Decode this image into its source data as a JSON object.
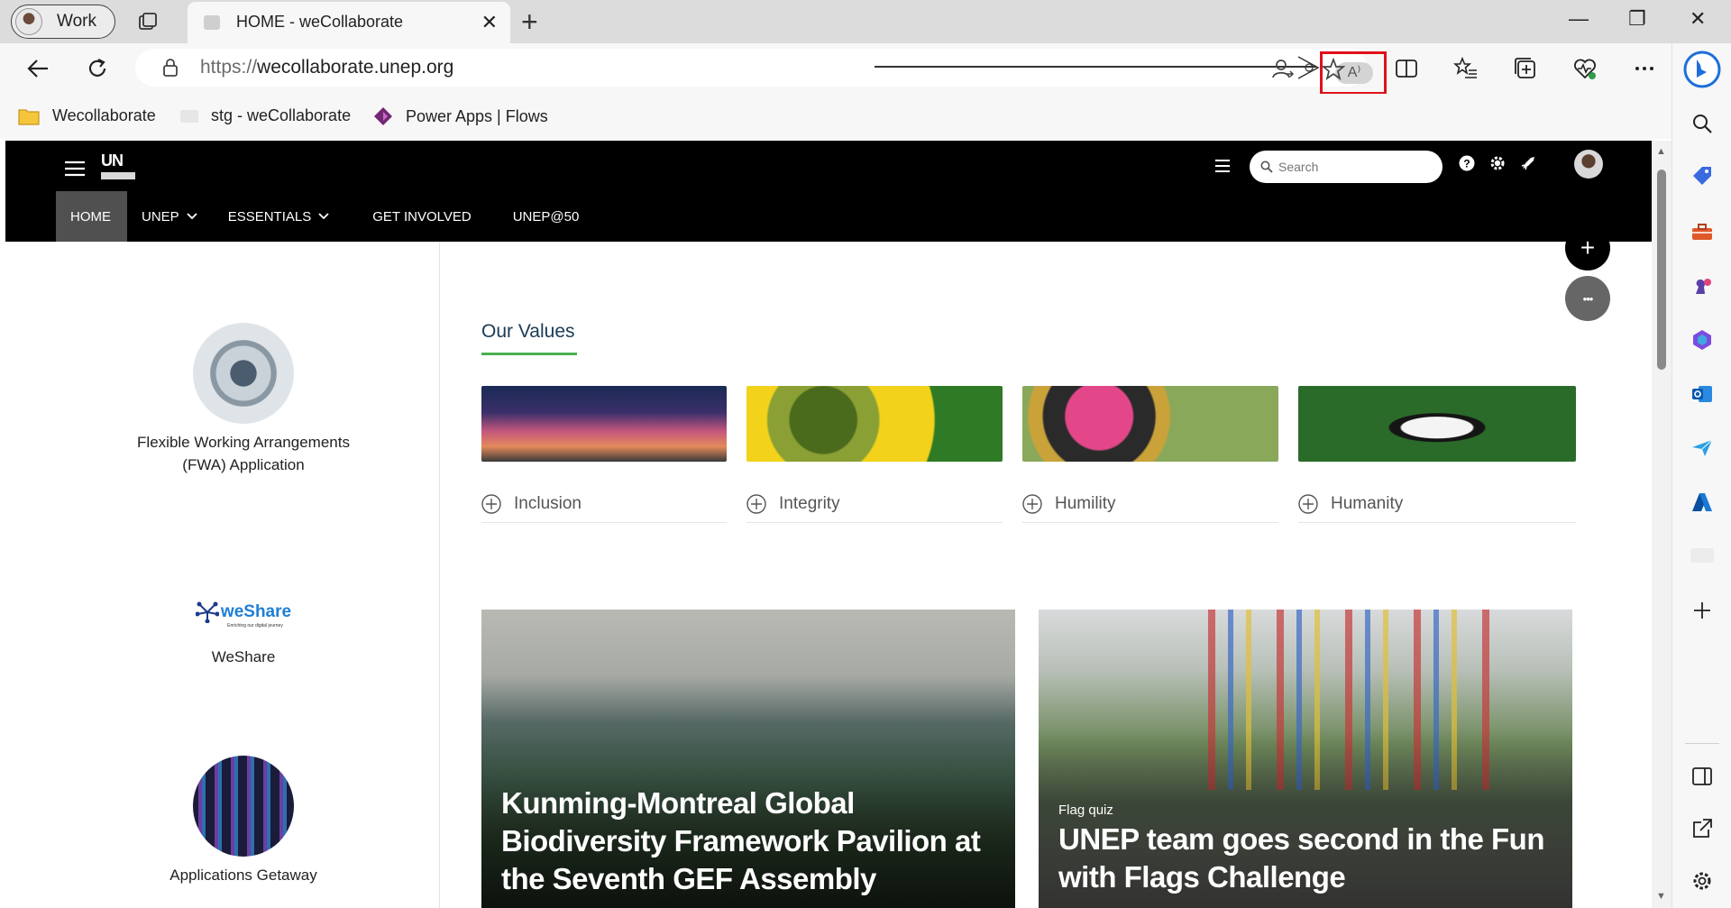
{
  "browser": {
    "profile_label": "Work",
    "tab_title": "HOME - weCollaborate",
    "tab_close": "✕",
    "new_tab": "+",
    "url_protocol": "https://",
    "url_host": "wecollaborate.unep.org",
    "read_aloud_glyph": "A⁾",
    "window_minimize": "—",
    "window_maximize": "❐",
    "window_close": "✕"
  },
  "favorites": [
    {
      "label": "Wecollaborate",
      "icon": "folder-icon"
    },
    {
      "label": "stg - weCollaborate",
      "icon": "site-favicon"
    },
    {
      "label": "Power Apps | Flows",
      "icon": "power-apps-icon"
    }
  ],
  "site": {
    "search_placeholder": "Search",
    "nav": [
      {
        "label": "HOME",
        "active": true
      },
      {
        "label": "UNEP",
        "dropdown": true
      },
      {
        "label": "ESSENTIALS",
        "dropdown": true
      },
      {
        "label": "GET INVOLVED"
      },
      {
        "label": "UNEP@50"
      }
    ],
    "fab_add": "+",
    "fab_more": "•••",
    "logo_text": "UN"
  },
  "apps": [
    {
      "label_line1": "Flexible Working Arrangements",
      "label_line2": "(FWA) Application"
    },
    {
      "logo_text": "weShare",
      "logo_tagline": "Enriching our digital journey",
      "label_line1": "WeShare"
    },
    {
      "label_line1": "Applications Getaway"
    }
  ],
  "values": {
    "title": "Our Values",
    "items": [
      {
        "label": "Inclusion"
      },
      {
        "label": "Integrity"
      },
      {
        "label": "Humility"
      },
      {
        "label": "Humanity"
      }
    ]
  },
  "news": [
    {
      "kicker": "",
      "headline": "Kunming-Montreal Global Biodiversity Framework Pavilion at the Seventh GEF Assembly"
    },
    {
      "kicker": "Flag quiz",
      "headline": "UNEP team goes second in the Fun with Flags Challenge"
    }
  ],
  "colors": {
    "accent_green": "#4caf50",
    "header_black": "#000000",
    "highlight_red": "#e0111a"
  }
}
